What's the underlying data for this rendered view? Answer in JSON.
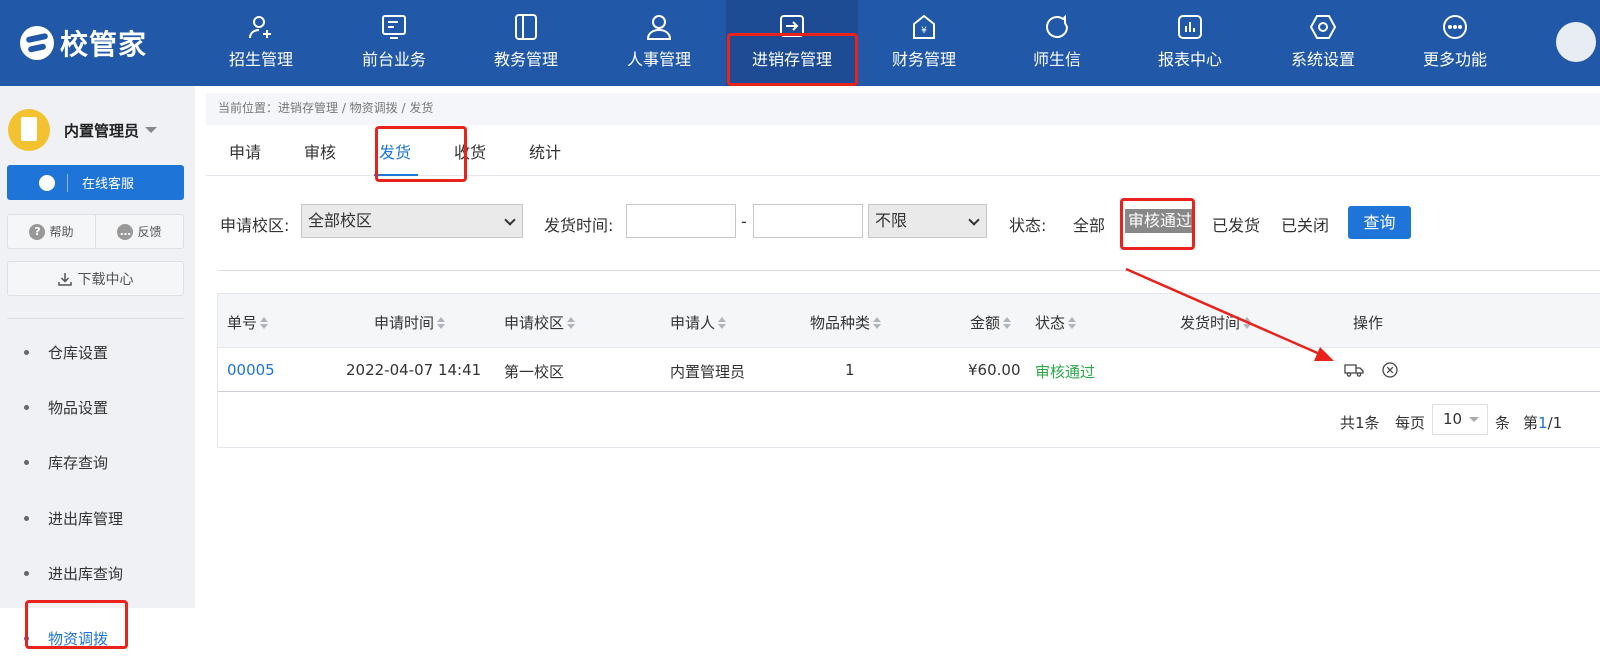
{
  "app": {
    "logo_text": "校管家"
  },
  "topnav": {
    "items": [
      {
        "label": "招生管理",
        "icon": "user-plus-icon"
      },
      {
        "label": "前台业务",
        "icon": "desk-icon"
      },
      {
        "label": "教务管理",
        "icon": "book-icon"
      },
      {
        "label": "人事管理",
        "icon": "person-icon"
      },
      {
        "label": "进销存管理",
        "icon": "arrow-in-box-icon",
        "active": true
      },
      {
        "label": "财务管理",
        "icon": "yen-house-icon"
      },
      {
        "label": "师生信",
        "icon": "chat-bubble-icon"
      },
      {
        "label": "报表中心",
        "icon": "bar-chart-icon"
      },
      {
        "label": "系统设置",
        "icon": "settings-hex-icon"
      },
      {
        "label": "更多功能",
        "icon": "more-dots-icon"
      }
    ]
  },
  "sidebar": {
    "user_name": "内置管理员",
    "service_label": "在线客服",
    "help_label": "帮助",
    "feedback_label": "反馈",
    "download_label": "下载中心",
    "menu": [
      {
        "label": "仓库设置"
      },
      {
        "label": "物品设置"
      },
      {
        "label": "库存查询"
      },
      {
        "label": "进出库管理"
      },
      {
        "label": "进出库查询"
      },
      {
        "label": "物资调拨",
        "active": true
      }
    ]
  },
  "breadcrumb": "当前位置：进销存管理 / 物资调拨 / 发货",
  "tabs": [
    {
      "label": "申请"
    },
    {
      "label": "审核"
    },
    {
      "label": "发货",
      "active": true
    },
    {
      "label": "收货"
    },
    {
      "label": "统计"
    }
  ],
  "filters": {
    "campus_label": "申请校区:",
    "campus_value": "全部校区",
    "ship_time_label": "发货时间:",
    "date_sep": "-",
    "range_value": "不限",
    "status_label": "状态:",
    "status_options": [
      "全部",
      "审核通过",
      "已发货",
      "已关闭"
    ],
    "status_selected": "审核通过",
    "query_label": "查询"
  },
  "table": {
    "columns": [
      "单号",
      "申请时间",
      "申请校区",
      "申请人",
      "物品种类",
      "金额",
      "状态",
      "发货时间",
      "操作"
    ],
    "rows": [
      {
        "no": "00005",
        "time": "2022-04-07 14:41",
        "campus": "第一校区",
        "applicant": "内置管理员",
        "kinds": "1",
        "amount": "¥60.00",
        "status": "审核通过",
        "ship_time": "",
        "actions": [
          "truck-icon",
          "close-circle-icon"
        ]
      }
    ]
  },
  "pager": {
    "total": "共1条",
    "per_page_label": "每页",
    "per_page_value": "10",
    "unit": "条",
    "page_prefix": "第",
    "page_current": "1",
    "page_rest": "/1"
  },
  "colors": {
    "nav": "#2158a8",
    "accent": "#1f74d8",
    "success": "#2aa84a",
    "annotation": "#e8231e"
  }
}
